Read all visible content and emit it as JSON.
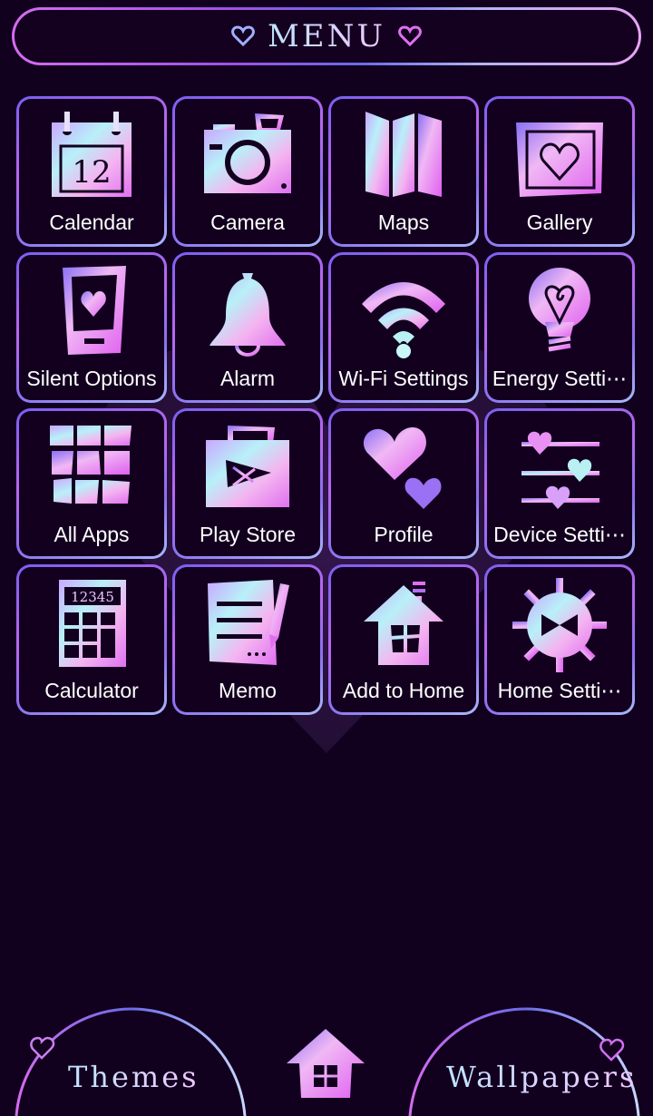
{
  "header": {
    "title": "MENU"
  },
  "colors": {
    "background": "#12001f",
    "tile_fill": "#13001f",
    "accent_pink": "#e080f0",
    "accent_blue": "#7a70f0",
    "accent_cyan": "#b8f0f4"
  },
  "tiles": [
    {
      "label": "Calendar",
      "icon": "calendar-icon",
      "value": "12"
    },
    {
      "label": "Camera",
      "icon": "camera-icon"
    },
    {
      "label": "Maps",
      "icon": "map-icon"
    },
    {
      "label": "Gallery",
      "icon": "gallery-icon"
    },
    {
      "label": "Silent Options",
      "icon": "phone-silent-icon"
    },
    {
      "label": "Alarm",
      "icon": "bell-icon"
    },
    {
      "label": "Wi-Fi Settings",
      "icon": "wifi-icon"
    },
    {
      "label": "Energy Setti⋯",
      "icon": "lightbulb-icon"
    },
    {
      "label": "All Apps",
      "icon": "grid-icon"
    },
    {
      "label": "Play Store",
      "icon": "shopping-bag-icon"
    },
    {
      "label": "Profile",
      "icon": "hearts-icon"
    },
    {
      "label": "Device Setti⋯",
      "icon": "sliders-icon"
    },
    {
      "label": "Calculator",
      "icon": "calculator-icon",
      "value": "12345"
    },
    {
      "label": "Memo",
      "icon": "memo-icon"
    },
    {
      "label": "Add to Home",
      "icon": "house-icon"
    },
    {
      "label": "Home Setti⋯",
      "icon": "gear-icon"
    }
  ],
  "footer": {
    "themes_label": "Themes",
    "wallpapers_label": "Wallpapers",
    "home_icon": "home-icon"
  }
}
